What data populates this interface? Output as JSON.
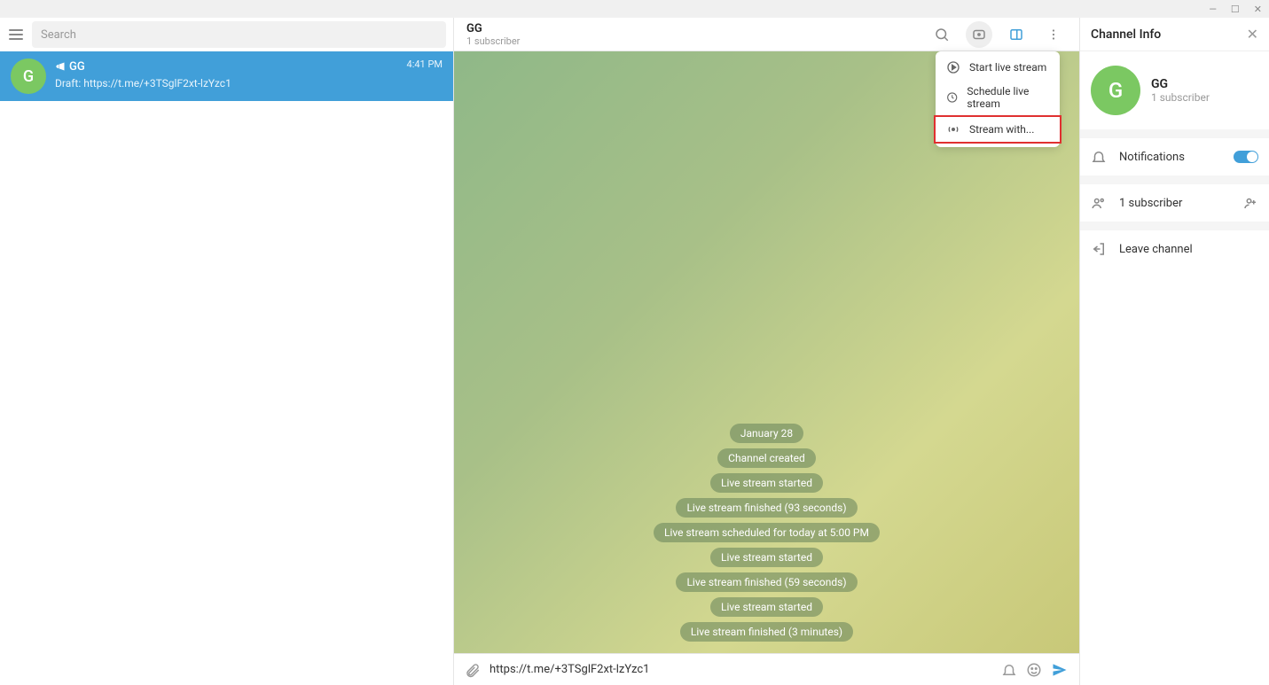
{
  "window": {
    "min": "—",
    "max": "☐",
    "close": "✕"
  },
  "search": {
    "placeholder": "Search"
  },
  "chatlist": {
    "item": {
      "avatar": "G",
      "name": "GG",
      "time": "4:41 PM",
      "draft_label": "Draft:",
      "draft_text": "https://t.me/+3TSglF2xt-lzYzc1"
    }
  },
  "header": {
    "title": "GG",
    "subtitle": "1 subscriber"
  },
  "dropdown": {
    "start": "Start live stream",
    "schedule": "Schedule live stream",
    "stream_with": "Stream with..."
  },
  "messages": [
    "January 28",
    "Channel created",
    "Live stream started",
    "Live stream finished (93 seconds)",
    "Live stream scheduled for today at 5:00 PM",
    "Live stream started",
    "Live stream finished (59 seconds)",
    "Live stream started",
    "Live stream finished (3 minutes)"
  ],
  "input": {
    "value": "https://t.me/+3TSglF2xt-lzYzc1"
  },
  "panel": {
    "title": "Channel Info",
    "avatar": "G",
    "name": "GG",
    "sub": "1 subscriber",
    "notifications": "Notifications",
    "subscribers": "1 subscriber",
    "leave": "Leave channel"
  }
}
